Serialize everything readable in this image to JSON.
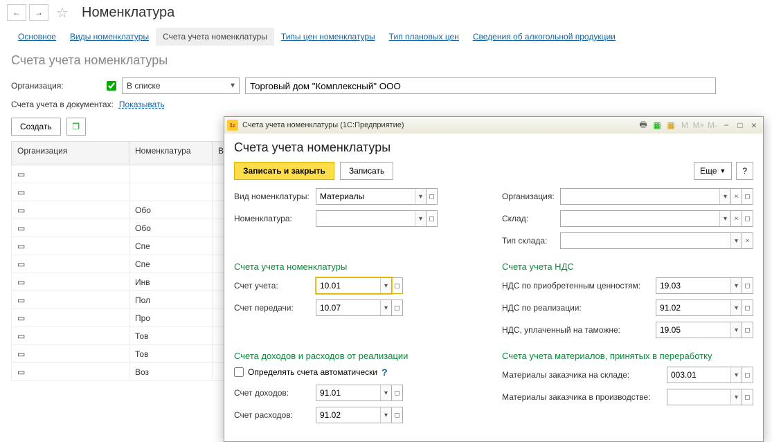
{
  "header": {
    "title": "Номенклатура"
  },
  "tabs": {
    "items": [
      {
        "label": "Основное"
      },
      {
        "label": "Виды номенклатуры"
      },
      {
        "label": "Счета учета номенклатуры"
      },
      {
        "label": "Типы цен номенклатуры"
      },
      {
        "label": "Тип плановых цен"
      },
      {
        "label": "Сведения об алкогольной продукции"
      }
    ]
  },
  "section": {
    "title": "Счета учета номенклатуры"
  },
  "filters": {
    "org_label": "Организация:",
    "in_list_label": "В списке",
    "org_value": "Торговый дом \"Комплексный\" ООО",
    "docs_label": "Счета учета в документах:",
    "show_link": "Показывать"
  },
  "toolbar": {
    "create_label": "Создать"
  },
  "grid": {
    "headers": {
      "org": "Организация",
      "nom": "Номенклатура",
      "kind": "Вид номе"
    },
    "rows": [
      {
        "nom": "",
        "kind": ""
      },
      {
        "nom": "",
        "kind": ""
      },
      {
        "nom": "Обо",
        "kind": ""
      },
      {
        "nom": "Обо",
        "kind": ""
      },
      {
        "nom": "Спе",
        "kind": ""
      },
      {
        "nom": "Спе",
        "kind": ""
      },
      {
        "nom": "Инв",
        "kind": ""
      },
      {
        "nom": "Пол",
        "kind": ""
      },
      {
        "nom": "Про",
        "kind": ""
      },
      {
        "nom": "Тов",
        "kind": ""
      },
      {
        "nom": "Тов",
        "kind": ""
      },
      {
        "nom": "Воз",
        "kind": ""
      }
    ]
  },
  "dialog": {
    "title_app": "Счета учета номенклатуры  (1С:Предприятие)",
    "title": "Счета учета номенклатуры",
    "buttons": {
      "save_close": "Записать и закрыть",
      "save": "Записать",
      "more": "Еще",
      "help": "?"
    },
    "left_top": {
      "kind_label": "Вид номенклатуры:",
      "kind_value": "Материалы",
      "nom_label": "Номенклатура:",
      "nom_value": ""
    },
    "right_top": {
      "org_label": "Организация:",
      "org_value": "",
      "wh_label": "Склад:",
      "wh_value": "",
      "whtype_label": "Тип склада:",
      "whtype_value": ""
    },
    "nom_accounts": {
      "head": "Счета учета номенклатуры",
      "acct_label": "Счет учета:",
      "acct_value": "10.01",
      "transfer_label": "Счет передачи:",
      "transfer_value": "10.07"
    },
    "vat_accounts": {
      "head": "Счета учета НДС",
      "acq_label": "НДС по приобретенным ценностям:",
      "acq_value": "19.03",
      "real_label": "НДС по реализации:",
      "real_value": "91.02",
      "cust_label": "НДС, уплаченный на таможне:",
      "cust_value": "19.05"
    },
    "realization": {
      "head": "Счета доходов и расходов от реализации",
      "auto_label": "Определять счета автоматически",
      "income_label": "Счет доходов:",
      "income_value": "91.01",
      "expense_label": "Счет расходов:",
      "expense_value": "91.02"
    },
    "materials": {
      "head": "Счета учета материалов, принятых в переработку",
      "wh_label": "Материалы заказчика на складе:",
      "wh_value": "003.01",
      "prod_label": "Материалы заказчика в производстве:",
      "prod_value": ""
    }
  },
  "tb_icons": {
    "m": "M",
    "mplus": "M+",
    "mminus": "M-"
  }
}
